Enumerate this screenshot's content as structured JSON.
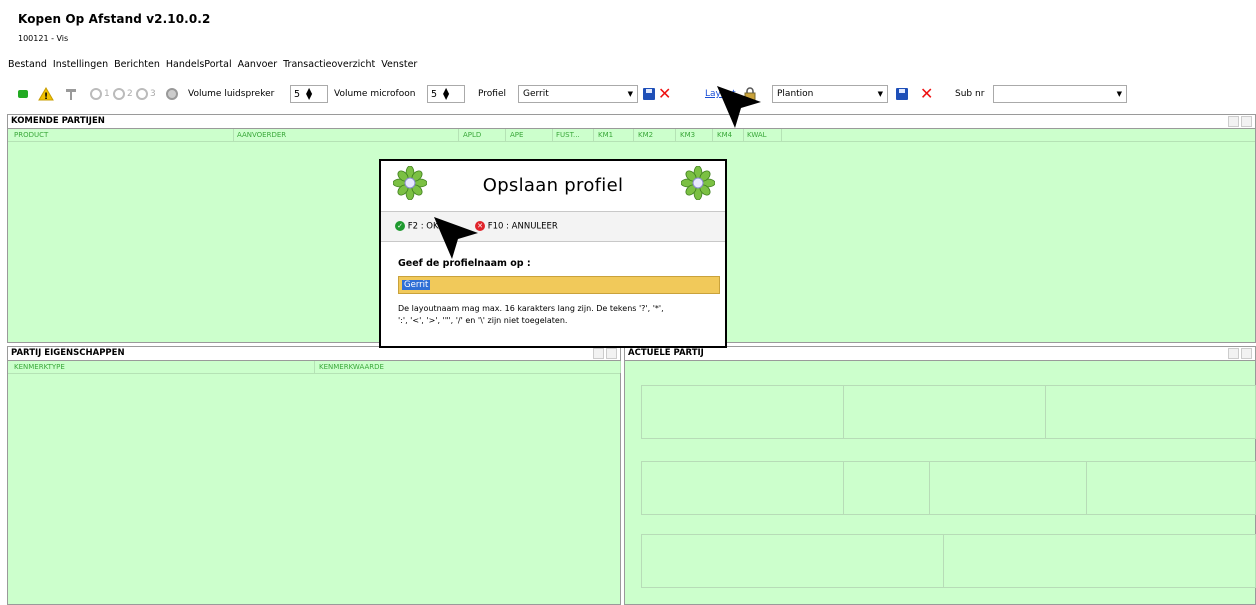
{
  "app": {
    "title": "Kopen Op Afstand v2.10.0.2",
    "subtitle": "100121 - Vis"
  },
  "menu": [
    "Bestand",
    "Instellingen",
    "Berichten",
    "HandelsPortal",
    "Aanvoer",
    "Transactieoverzicht",
    "Venster"
  ],
  "toolbar": {
    "status_icons": [
      "green-status-icon",
      "warning-icon",
      "hammer-icon",
      "clock-1-icon",
      "clock-2-icon",
      "clock-3-icon",
      "gear-icon"
    ],
    "clock_labels": [
      "1",
      "2",
      "3"
    ],
    "speaker_label": "Volume luidspreker",
    "speaker_value": "5",
    "mic_label": "Volume microfoon",
    "mic_value": "5",
    "profile_label": "Profiel",
    "profile_value": "Gerrit",
    "layout_link": "Layout",
    "layout_value": "Plantion",
    "subnr_label": "Sub nr",
    "subnr_value": ""
  },
  "panels": {
    "komende": {
      "title": "KOMENDE PARTIJEN",
      "columns": [
        "PRODUCT",
        "AANVOERDER",
        "APLD",
        "APE",
        "FUST...",
        "KM1",
        "KM2",
        "KM3",
        "KM4",
        "KWAL"
      ]
    },
    "eigenschappen": {
      "title": "PARTIJ EIGENSCHAPPEN",
      "columns": [
        "KENMERKTYPE",
        "KENMERKWAARDE"
      ]
    },
    "actuele": {
      "title": "ACTUELE PARTIJ"
    }
  },
  "dialog": {
    "title": "Opslaan profiel",
    "ok_label": "F2 : OK",
    "cancel_label": "F10 : ANNULEER",
    "prompt": "Geef de profielnaam op :",
    "input_value": "Gerrit",
    "help_line1": "De layoutnaam mag max. 16 karakters lang zijn. De tekens '?', '*',",
    "help_line2": "':', '<', '>', '\"', '/' en '\\' zijn niet toegelaten."
  },
  "colors": {
    "panel_bg": "#ccffcc",
    "accent_green": "#3aa83a",
    "input_bg": "#f1c95a",
    "selection": "#2f6fd6"
  }
}
